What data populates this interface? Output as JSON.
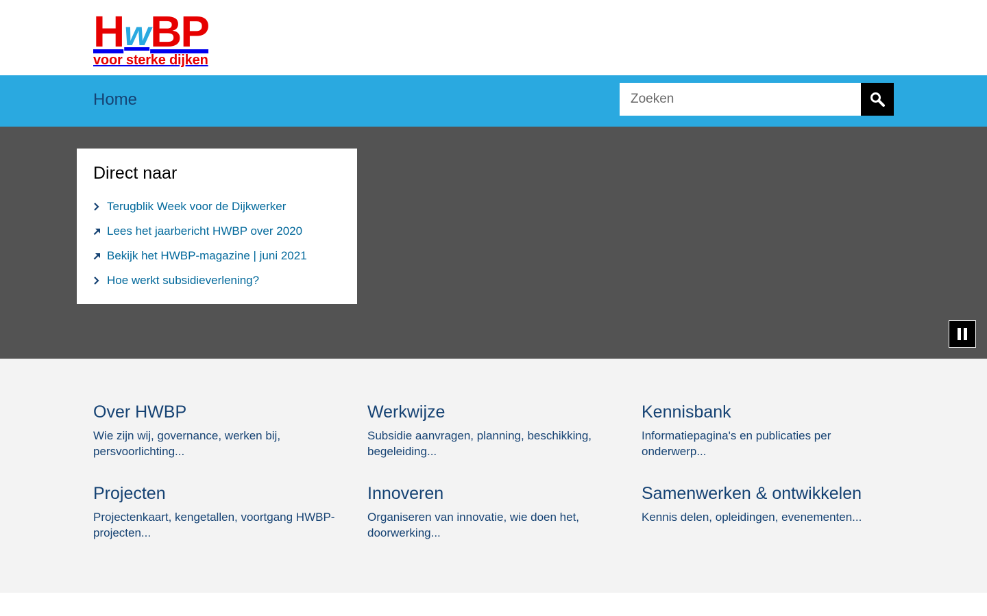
{
  "logo": {
    "mark_left": "H",
    "mark_w": "w",
    "mark_right": "BP",
    "tagline": "voor sterke dijken"
  },
  "nav": {
    "home": "Home"
  },
  "search": {
    "placeholder": "Zoeken",
    "value": ""
  },
  "direct": {
    "title": "Direct naar",
    "items": [
      {
        "label": "Terugblik Week voor de Dijkwerker",
        "icon": "chevron-right-icon"
      },
      {
        "label": "Lees het jaarbericht HWBP over 2020",
        "icon": "external-arrow-icon"
      },
      {
        "label": "Bekijk het HWBP-magazine | juni 2021",
        "icon": "external-arrow-icon"
      },
      {
        "label": "Hoe werkt subsidieverlening?",
        "icon": "chevron-right-icon"
      }
    ]
  },
  "tiles": [
    {
      "title": "Over HWBP",
      "desc": "Wie zijn wij, governance, werken bij, persvoorlichting..."
    },
    {
      "title": "Werkwijze",
      "desc": "Subsidie aanvragen, planning, beschikking, begeleiding..."
    },
    {
      "title": "Kennisbank",
      "desc": "Informatiepagina's en publicaties per onderwerp..."
    },
    {
      "title": "Projecten",
      "desc": "Projectenkaart, kengetallen, voortgang HWBP-projecten..."
    },
    {
      "title": "Innoveren",
      "desc": "Organiseren van innovatie, wie doen het, doorwerking..."
    },
    {
      "title": "Samenwerken & ontwikkelen",
      "desc": "Kennis delen, opleidingen, evenementen..."
    }
  ],
  "colors": {
    "brand_red": "#e60000",
    "brand_blue": "#2aa9e0",
    "text_navy": "#154273",
    "link_blue": "#01689b",
    "hero_gray": "#535353"
  }
}
